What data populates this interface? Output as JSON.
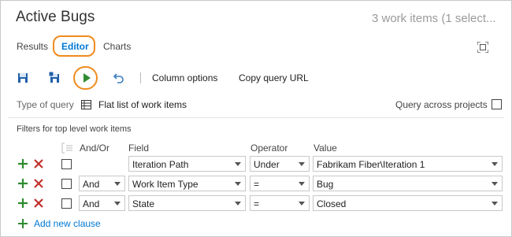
{
  "header": {
    "title": "Active Bugs",
    "item_count": "3 work items (1 select..."
  },
  "tabs": [
    {
      "label": "Results"
    },
    {
      "label": "Editor"
    },
    {
      "label": "Charts"
    }
  ],
  "toolbar": {
    "column_options": "Column options",
    "copy_query_url": "Copy query URL"
  },
  "query_type": {
    "label": "Type of query",
    "value": "Flat list of work items",
    "across_projects_label": "Query across projects"
  },
  "filters": {
    "section_label": "Filters for top level work items",
    "headers": {
      "and_or": "And/Or",
      "field": "Field",
      "operator": "Operator",
      "value": "Value"
    },
    "rows": [
      {
        "and_or": "",
        "field": "Iteration Path",
        "operator": "Under",
        "value": "Fabrikam Fiber\\Iteration 1"
      },
      {
        "and_or": "And",
        "field": "Work Item Type",
        "operator": "=",
        "value": "Bug"
      },
      {
        "and_or": "And",
        "field": "State",
        "operator": "=",
        "value": "Closed"
      }
    ],
    "add_clause": "Add new clause"
  },
  "colors": {
    "accent": "#0078d4",
    "highlight": "#f08b1d",
    "add_green": "#2e8b2e",
    "delete_red": "#c0312b"
  }
}
